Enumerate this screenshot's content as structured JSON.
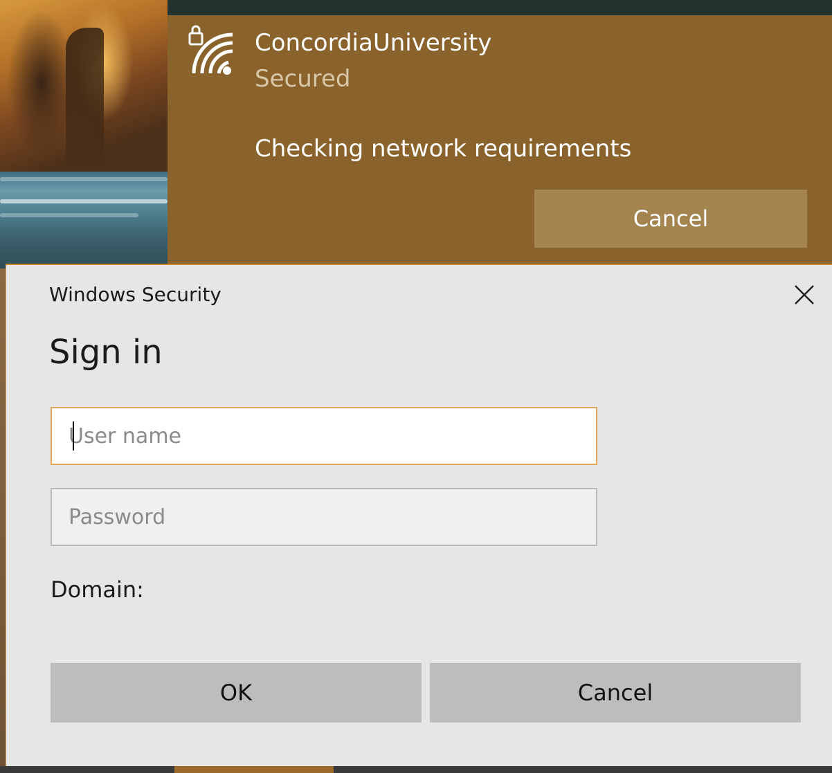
{
  "network_flyout": {
    "network_name": "ConcordiaUniversity",
    "security_status": "Secured",
    "message": "Checking network requirements",
    "cancel_label": "Cancel",
    "icon": "secured-wifi-icon"
  },
  "sign_in_dialog": {
    "window_title": "Windows Security",
    "heading": "Sign in",
    "username": {
      "value": "",
      "placeholder": "User name"
    },
    "password": {
      "value": "",
      "placeholder": "Password"
    },
    "domain_label": "Domain:",
    "ok_label": "OK",
    "cancel_label": "Cancel",
    "close_icon": "close-icon"
  },
  "colors": {
    "flyout_background": "#8a622b",
    "flyout_button": "#a4844f",
    "dialog_background": "#e6e6e6",
    "focus_border": "#e0a65a",
    "dialog_button": "#bdbdbd"
  }
}
